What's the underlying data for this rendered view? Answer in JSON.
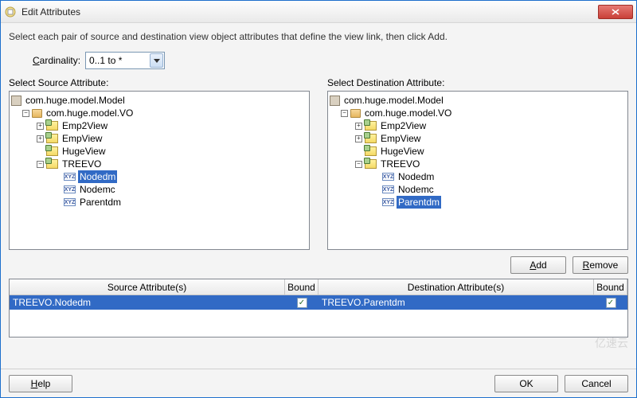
{
  "title": "Edit Attributes",
  "instruction": "Select each pair of source and destination view object attributes that define the view link, then click Add.",
  "cardinality": {
    "label_pre": "C",
    "label_post": "ardinality:",
    "value": "0..1 to *"
  },
  "source": {
    "label": "Select Source Attribute:",
    "root": "com.huge.model.Model",
    "pkg": "com.huge.model.VO",
    "views": [
      "Emp2View",
      "EmpView",
      "HugeView",
      "TREEVO"
    ],
    "attrs": [
      "Nodedm",
      "Nodemc",
      "Parentdm"
    ],
    "selected": "Nodedm"
  },
  "dest": {
    "label": "Select Destination Attribute:",
    "root": "com.huge.model.Model",
    "pkg": "com.huge.model.VO",
    "views": [
      "Emp2View",
      "EmpView",
      "HugeView",
      "TREEVO"
    ],
    "attrs": [
      "Nodedm",
      "Nodemc",
      "Parentdm"
    ],
    "selected": "Parentdm"
  },
  "buttons": {
    "add_pre": "A",
    "add_post": "dd",
    "remove_pre": "R",
    "remove_post": "emove",
    "help_pre": "H",
    "help_post": "elp",
    "ok": "OK",
    "cancel": "Cancel"
  },
  "table": {
    "h_src": "Source Attribute(s)",
    "h_bound": "Bound",
    "h_dst": "Destination Attribute(s)",
    "row": {
      "src": "TREEVO.Nodedm",
      "dst": "TREEVO.Parentdm",
      "src_bound": true,
      "dst_bound": true
    }
  },
  "watermark": "亿速云"
}
